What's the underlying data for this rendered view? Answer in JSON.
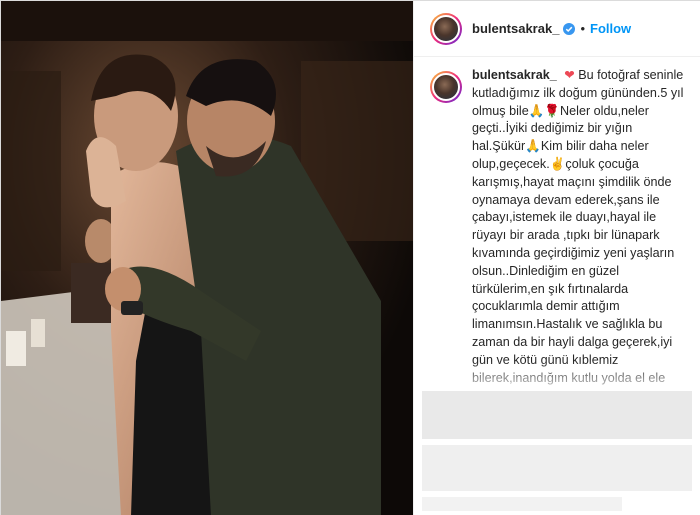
{
  "post": {
    "username": "bulentsakrak_",
    "separator": "•",
    "follow_label": "Follow",
    "verified_icon": "verified-badge-icon",
    "accent_color": "#0095f6",
    "heart_color": "#ed4956"
  },
  "caption": {
    "username": "bulentsakrak_",
    "emoji_heart": "❤",
    "text": "Bu fotoğraf seninle kutladığımız ilk doğum gününden.5 yıl olmuş bile🙏🌹Neler oldu,neler geçti..İyiki dediğimiz bir yığın hal.Şükür🙏Kim bilir daha neler olup,geçecek.✌çoluk çocuğa karışmış,hayat maçını şimdilik önde oynamaya devam ederek,şans ile çabayı,istemek ile duayı,hayal ile rüyayı bir arada ,tıpkı bir lünapark kıvamında geçirdiğimiz yeni yaşların olsun..Dinlediğim en güzel türkülerim,en şık fırtınalarda çocuklarımla demir attığım limanımsın.Hastalık ve sağlıkla bu zaman da bir hayli dalga geçerek,iyi gün ve kötü günü kıblemiz bilerek,inandığım kutlu yolda el ele yürüdüğümsün.Yaşların,yaşlarımız nice olsun. Hakkı kayıyı sakla ve birisi SEN!"
  }
}
